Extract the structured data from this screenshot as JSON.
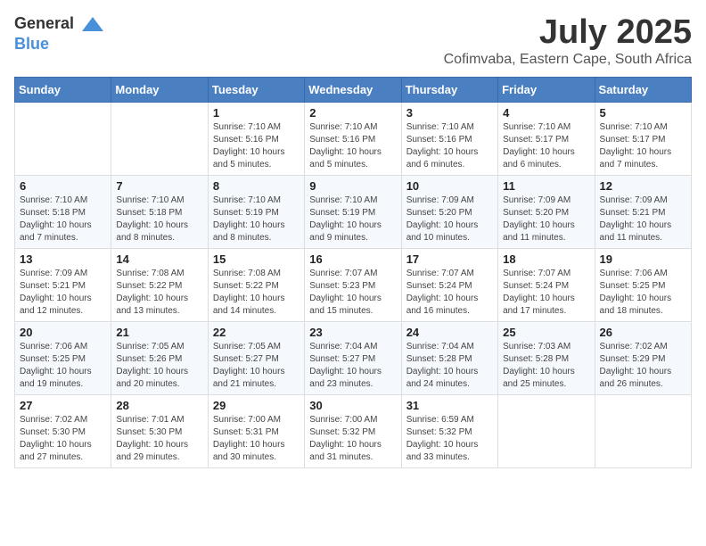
{
  "logo": {
    "general": "General",
    "blue": "Blue"
  },
  "title": "July 2025",
  "location": "Cofimvaba, Eastern Cape, South Africa",
  "weekdays": [
    "Sunday",
    "Monday",
    "Tuesday",
    "Wednesday",
    "Thursday",
    "Friday",
    "Saturday"
  ],
  "weeks": [
    [
      {
        "day": "",
        "info": ""
      },
      {
        "day": "",
        "info": ""
      },
      {
        "day": "1",
        "info": "Sunrise: 7:10 AM\nSunset: 5:16 PM\nDaylight: 10 hours and 5 minutes."
      },
      {
        "day": "2",
        "info": "Sunrise: 7:10 AM\nSunset: 5:16 PM\nDaylight: 10 hours and 5 minutes."
      },
      {
        "day": "3",
        "info": "Sunrise: 7:10 AM\nSunset: 5:16 PM\nDaylight: 10 hours and 6 minutes."
      },
      {
        "day": "4",
        "info": "Sunrise: 7:10 AM\nSunset: 5:17 PM\nDaylight: 10 hours and 6 minutes."
      },
      {
        "day": "5",
        "info": "Sunrise: 7:10 AM\nSunset: 5:17 PM\nDaylight: 10 hours and 7 minutes."
      }
    ],
    [
      {
        "day": "6",
        "info": "Sunrise: 7:10 AM\nSunset: 5:18 PM\nDaylight: 10 hours and 7 minutes."
      },
      {
        "day": "7",
        "info": "Sunrise: 7:10 AM\nSunset: 5:18 PM\nDaylight: 10 hours and 8 minutes."
      },
      {
        "day": "8",
        "info": "Sunrise: 7:10 AM\nSunset: 5:19 PM\nDaylight: 10 hours and 8 minutes."
      },
      {
        "day": "9",
        "info": "Sunrise: 7:10 AM\nSunset: 5:19 PM\nDaylight: 10 hours and 9 minutes."
      },
      {
        "day": "10",
        "info": "Sunrise: 7:09 AM\nSunset: 5:20 PM\nDaylight: 10 hours and 10 minutes."
      },
      {
        "day": "11",
        "info": "Sunrise: 7:09 AM\nSunset: 5:20 PM\nDaylight: 10 hours and 11 minutes."
      },
      {
        "day": "12",
        "info": "Sunrise: 7:09 AM\nSunset: 5:21 PM\nDaylight: 10 hours and 11 minutes."
      }
    ],
    [
      {
        "day": "13",
        "info": "Sunrise: 7:09 AM\nSunset: 5:21 PM\nDaylight: 10 hours and 12 minutes."
      },
      {
        "day": "14",
        "info": "Sunrise: 7:08 AM\nSunset: 5:22 PM\nDaylight: 10 hours and 13 minutes."
      },
      {
        "day": "15",
        "info": "Sunrise: 7:08 AM\nSunset: 5:22 PM\nDaylight: 10 hours and 14 minutes."
      },
      {
        "day": "16",
        "info": "Sunrise: 7:07 AM\nSunset: 5:23 PM\nDaylight: 10 hours and 15 minutes."
      },
      {
        "day": "17",
        "info": "Sunrise: 7:07 AM\nSunset: 5:24 PM\nDaylight: 10 hours and 16 minutes."
      },
      {
        "day": "18",
        "info": "Sunrise: 7:07 AM\nSunset: 5:24 PM\nDaylight: 10 hours and 17 minutes."
      },
      {
        "day": "19",
        "info": "Sunrise: 7:06 AM\nSunset: 5:25 PM\nDaylight: 10 hours and 18 minutes."
      }
    ],
    [
      {
        "day": "20",
        "info": "Sunrise: 7:06 AM\nSunset: 5:25 PM\nDaylight: 10 hours and 19 minutes."
      },
      {
        "day": "21",
        "info": "Sunrise: 7:05 AM\nSunset: 5:26 PM\nDaylight: 10 hours and 20 minutes."
      },
      {
        "day": "22",
        "info": "Sunrise: 7:05 AM\nSunset: 5:27 PM\nDaylight: 10 hours and 21 minutes."
      },
      {
        "day": "23",
        "info": "Sunrise: 7:04 AM\nSunset: 5:27 PM\nDaylight: 10 hours and 23 minutes."
      },
      {
        "day": "24",
        "info": "Sunrise: 7:04 AM\nSunset: 5:28 PM\nDaylight: 10 hours and 24 minutes."
      },
      {
        "day": "25",
        "info": "Sunrise: 7:03 AM\nSunset: 5:28 PM\nDaylight: 10 hours and 25 minutes."
      },
      {
        "day": "26",
        "info": "Sunrise: 7:02 AM\nSunset: 5:29 PM\nDaylight: 10 hours and 26 minutes."
      }
    ],
    [
      {
        "day": "27",
        "info": "Sunrise: 7:02 AM\nSunset: 5:30 PM\nDaylight: 10 hours and 27 minutes."
      },
      {
        "day": "28",
        "info": "Sunrise: 7:01 AM\nSunset: 5:30 PM\nDaylight: 10 hours and 29 minutes."
      },
      {
        "day": "29",
        "info": "Sunrise: 7:00 AM\nSunset: 5:31 PM\nDaylight: 10 hours and 30 minutes."
      },
      {
        "day": "30",
        "info": "Sunrise: 7:00 AM\nSunset: 5:32 PM\nDaylight: 10 hours and 31 minutes."
      },
      {
        "day": "31",
        "info": "Sunrise: 6:59 AM\nSunset: 5:32 PM\nDaylight: 10 hours and 33 minutes."
      },
      {
        "day": "",
        "info": ""
      },
      {
        "day": "",
        "info": ""
      }
    ]
  ]
}
